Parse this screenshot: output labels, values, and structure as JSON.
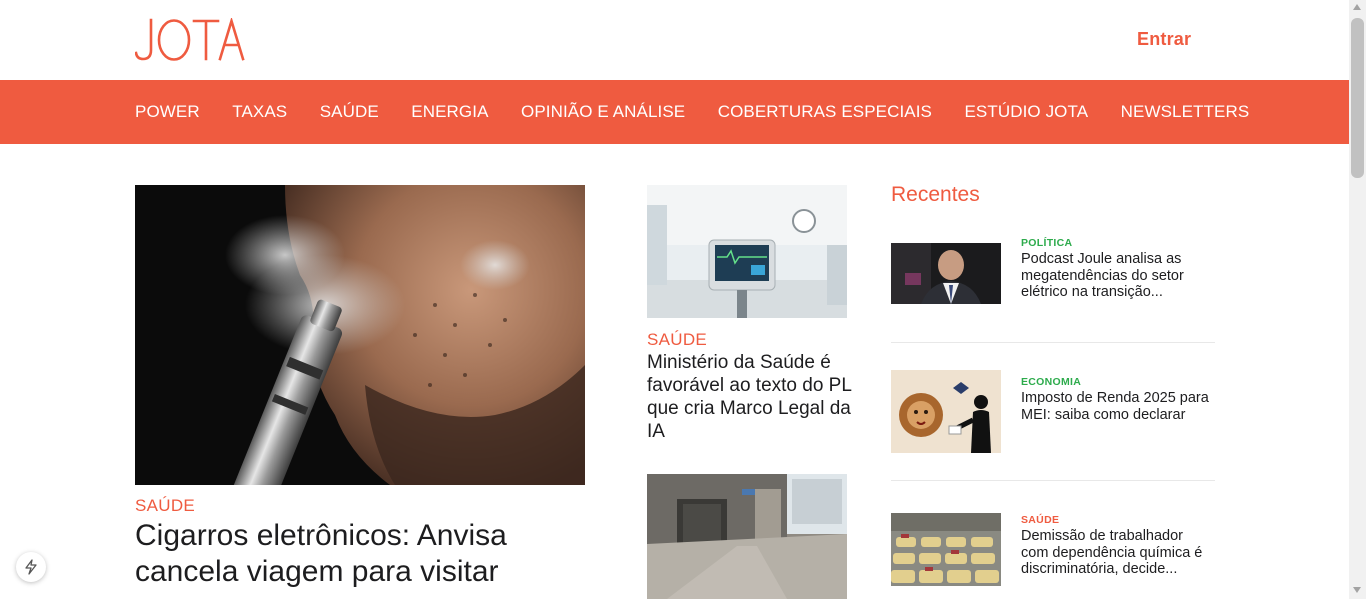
{
  "header": {
    "logo_text": "JOTA",
    "login_label": "Entrar"
  },
  "nav": {
    "items": [
      "POWER",
      "TAXAS",
      "SAÚDE",
      "ENERGIA",
      "OPINIÃO E ANÁLISE",
      "COBERTURAS ESPECIAIS",
      "ESTÚDIO JOTA",
      "NEWSLETTERS"
    ]
  },
  "main": {
    "hero": {
      "category": "SAÚDE",
      "title": "Cigarros eletrônicos: Anvisa cancela viagem para visitar"
    },
    "secondary": [
      {
        "category": "SAÚDE",
        "title": "Ministério da Saúde é favorável ao texto do PL que cria Marco Legal da IA"
      }
    ]
  },
  "recent": {
    "heading": "Recentes",
    "items": [
      {
        "category": "POLÍTICA",
        "category_color": "#2dab4c",
        "title": "Podcast Joule analisa as megatendências do setor elétrico na transição..."
      },
      {
        "category": "ECONOMIA",
        "category_color": "#2dab4c",
        "title": "Imposto de Renda 2025 para MEI: saiba como declarar"
      },
      {
        "category": "SAÚDE",
        "category_color": "#ef5b40",
        "title": "Demissão de trabalhador com dependência química é discriminatória, decide..."
      }
    ]
  },
  "colors": {
    "brand": "#ef5b40",
    "text": "#1d1d1f",
    "green_category": "#2dab4c"
  }
}
